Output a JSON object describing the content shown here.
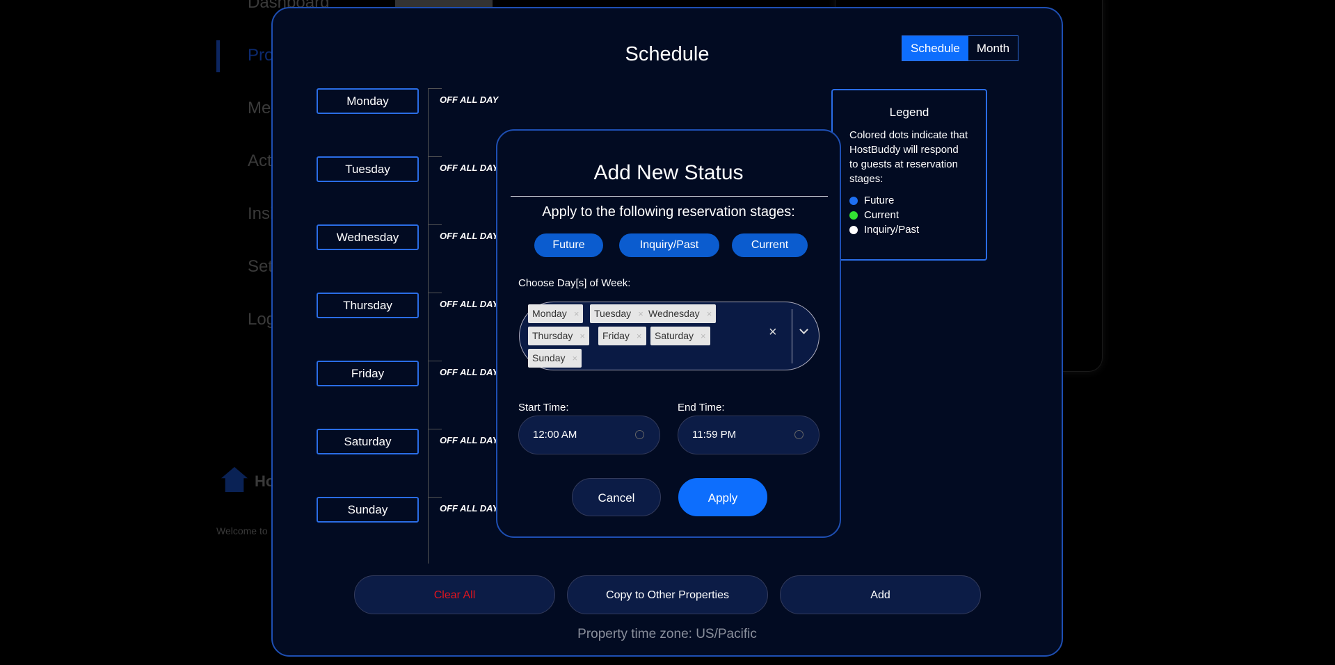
{
  "sidebar": {
    "items": [
      {
        "label": "Dashboard"
      },
      {
        "label": "Pro"
      },
      {
        "label": "Me"
      },
      {
        "label": "Act"
      },
      {
        "label": "Insi"
      },
      {
        "label": "Set"
      },
      {
        "label": "Log"
      }
    ],
    "brand": "Ho",
    "welcome": "Welcome to"
  },
  "schedule": {
    "title": "Schedule",
    "views": [
      "Schedule",
      "Month"
    ],
    "days": [
      {
        "name": "Monday",
        "status": "OFF ALL DAY"
      },
      {
        "name": "Tuesday",
        "status": "OFF ALL DAY"
      },
      {
        "name": "Wednesday",
        "status": "OFF ALL DAY"
      },
      {
        "name": "Thursday",
        "status": "OFF ALL DAY"
      },
      {
        "name": "Friday",
        "status": "OFF ALL DAY"
      },
      {
        "name": "Saturday",
        "status": "OFF ALL DAY"
      },
      {
        "name": "Sunday",
        "status": "OFF ALL DAY"
      }
    ],
    "buttons": {
      "clear": "Clear All",
      "copy": "Copy to Other Properties",
      "add": "Add"
    },
    "timezone": "Property time zone: US/Pacific"
  },
  "legend": {
    "title": "Legend",
    "text": "Colored dots indicate that HostBuddy will respond to guests at reservation stages:",
    "items": [
      {
        "label": "Future",
        "color": "#1e6ff0"
      },
      {
        "label": "Current",
        "color": "#33e333"
      },
      {
        "label": "Inquiry/Past",
        "color": "#ffffff"
      }
    ]
  },
  "dialog": {
    "title": "Add New Status",
    "stages_label": "Apply to the following reservation stages:",
    "stages": [
      "Future",
      "Inquiry/Past",
      "Current"
    ],
    "days_label": "Choose Day[s] of Week:",
    "selected_days": [
      "Monday",
      "Tuesday",
      "Wednesday",
      "Thursday",
      "Friday",
      "Saturday",
      "Sunday"
    ],
    "start_label": "Start Time:",
    "start_value": "12:00 AM",
    "end_label": "End Time:",
    "end_value": "11:59 PM",
    "cancel": "Cancel",
    "apply": "Apply"
  },
  "colors": {
    "accent": "#0d6efd",
    "border": "#1e4fb3",
    "danger": "#e0141e"
  }
}
